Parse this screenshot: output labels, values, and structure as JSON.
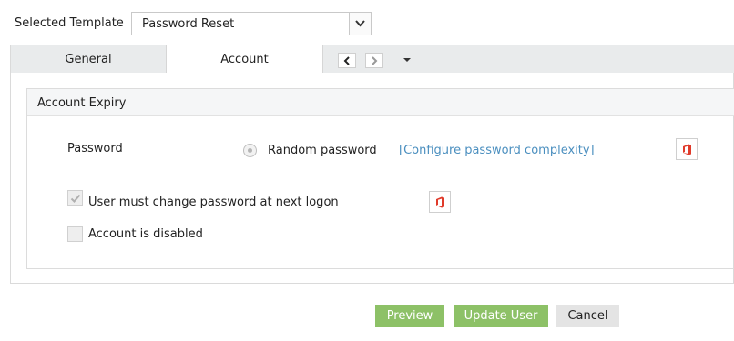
{
  "template": {
    "label": "Selected Template",
    "value": "Password Reset"
  },
  "tabs": [
    {
      "label": "General"
    },
    {
      "label": "Account"
    }
  ],
  "section": {
    "title": "Account Expiry"
  },
  "password": {
    "label": "Password",
    "option_label": "Random password",
    "complexity_link": "[Configure password complexity]"
  },
  "checkboxes": [
    {
      "label": "User must change password at next logon",
      "checked": true
    },
    {
      "label": "Account is disabled",
      "checked": false
    }
  ],
  "buttons": {
    "preview": "Preview",
    "update": "Update User",
    "cancel": "Cancel"
  },
  "colors": {
    "accent_green": "#8dc167",
    "link_blue": "#4b8fbf",
    "office_red": "#e03a2a"
  },
  "icons": {
    "dropdown": "chevron-down-icon",
    "prev": "chevron-left-icon",
    "next": "chevron-right-icon",
    "tab_menu": "caret-down-icon",
    "office": "office365-icon"
  }
}
